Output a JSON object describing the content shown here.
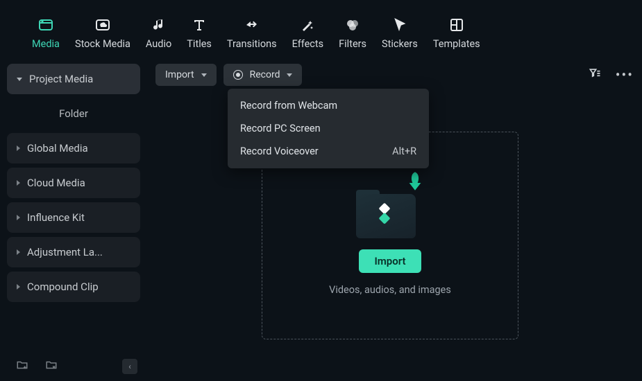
{
  "topnav": [
    {
      "label": "Media"
    },
    {
      "label": "Stock Media"
    },
    {
      "label": "Audio"
    },
    {
      "label": "Titles"
    },
    {
      "label": "Transitions"
    },
    {
      "label": "Effects"
    },
    {
      "label": "Filters"
    },
    {
      "label": "Stickers"
    },
    {
      "label": "Templates"
    }
  ],
  "sidebar": {
    "project_media": "Project Media",
    "folder": "Folder",
    "items": [
      {
        "label": "Global Media"
      },
      {
        "label": "Cloud Media"
      },
      {
        "label": "Influence Kit"
      },
      {
        "label": "Adjustment La..."
      },
      {
        "label": "Compound Clip"
      }
    ]
  },
  "toolbar": {
    "import_label": "Import",
    "record_label": "Record"
  },
  "record_menu": [
    {
      "label": "Record from Webcam",
      "shortcut": ""
    },
    {
      "label": "Record PC Screen",
      "shortcut": ""
    },
    {
      "label": "Record Voiceover",
      "shortcut": "Alt+R"
    }
  ],
  "dropzone": {
    "button": "Import",
    "caption": "Videos, audios, and images"
  }
}
